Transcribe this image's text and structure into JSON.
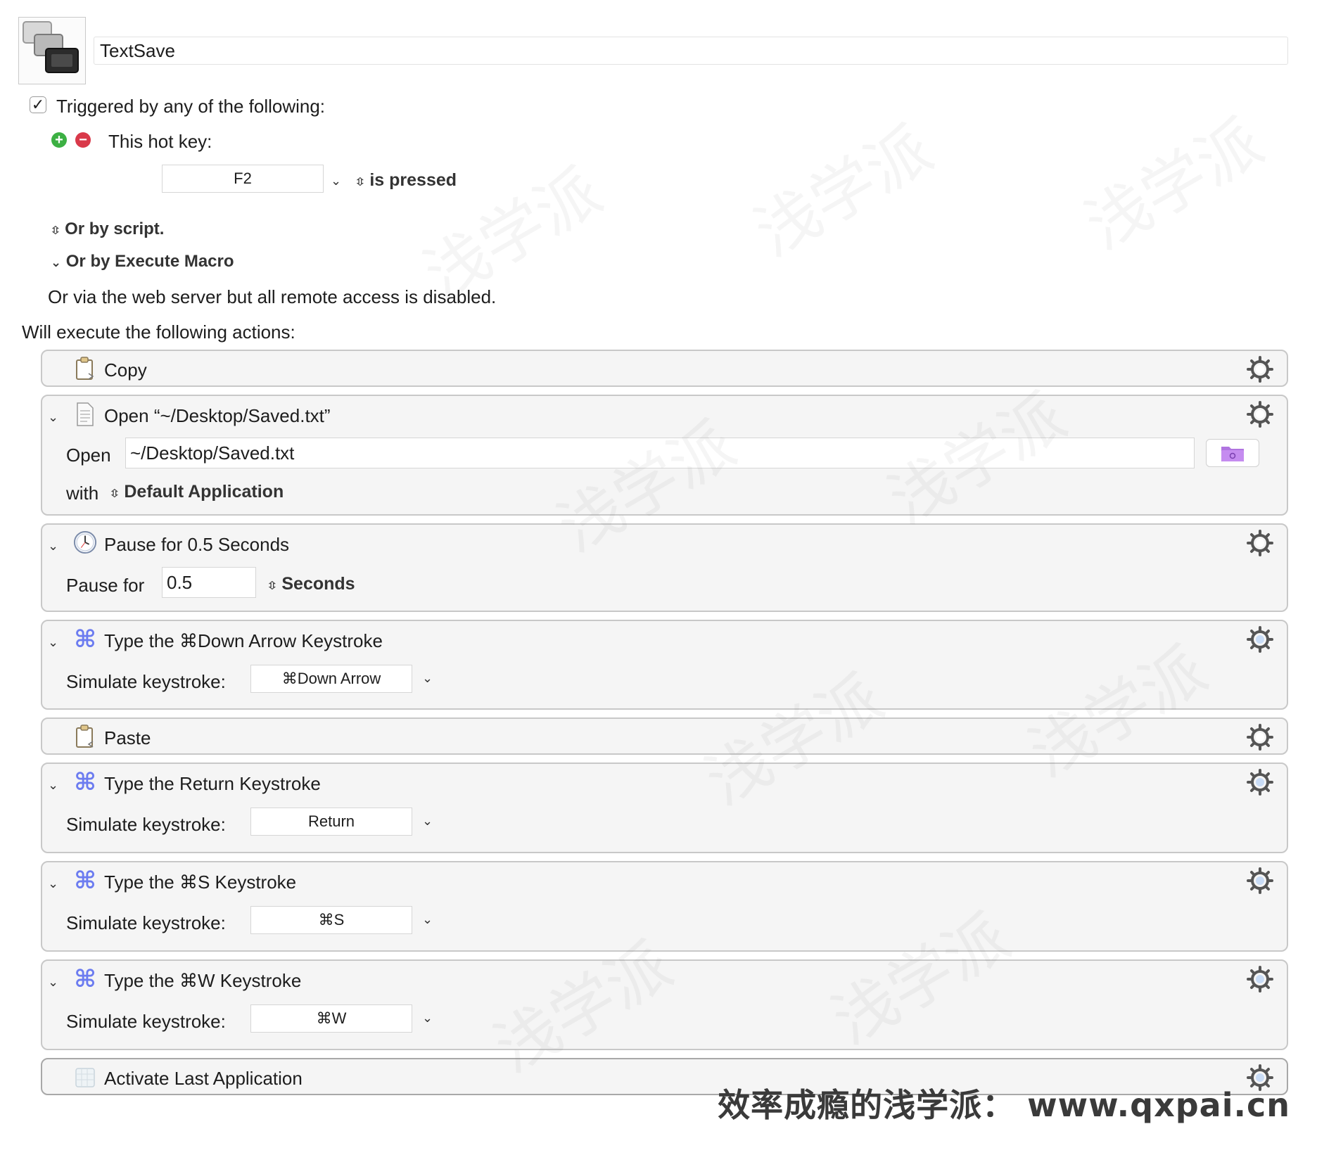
{
  "macro": {
    "name": "TextSave"
  },
  "trigger": {
    "header": "Triggered by any of the following:",
    "enabled": true,
    "hotkey_label": "This hot key:",
    "hotkey_value": "F2",
    "hotkey_state": "is pressed",
    "or_script": "Or by script.",
    "or_execute_macro": "Or by Execute Macro",
    "web_server_note": "Or via the web server but all remote access is disabled."
  },
  "actions_header": "Will execute the following actions:",
  "actions": {
    "copy": {
      "title": "Copy"
    },
    "open": {
      "title": "Open “~/Desktop/Saved.txt”",
      "open_label": "Open",
      "path": "~/Desktop/Saved.txt",
      "with_label": "with",
      "application": "Default Application"
    },
    "pause": {
      "title": "Pause for 0.5 Seconds",
      "label": "Pause for",
      "value": "0.5",
      "unit": "Seconds"
    },
    "type_down": {
      "title": "Type the ⌘Down Arrow Keystroke",
      "label": "Simulate keystroke:",
      "key": "⌘Down Arrow"
    },
    "paste": {
      "title": "Paste"
    },
    "type_return": {
      "title": "Type the Return Keystroke",
      "label": "Simulate keystroke:",
      "key": "Return"
    },
    "type_s": {
      "title": "Type the ⌘S Keystroke",
      "label": "Simulate keystroke:",
      "key": "⌘S"
    },
    "type_w": {
      "title": "Type the ⌘W Keystroke",
      "label": "Simulate keystroke:",
      "key": "⌘W"
    },
    "activate": {
      "title": "Activate Last Application"
    }
  },
  "watermark": {
    "repeated": "浅学派",
    "footer": "效率成瘾的浅学派： www.qxpai.cn"
  },
  "colors": {
    "add_button": "#3cb043",
    "remove_button": "#d9394a",
    "command_icon": "#6c7cf0",
    "folder_icon": "#b074e0"
  }
}
